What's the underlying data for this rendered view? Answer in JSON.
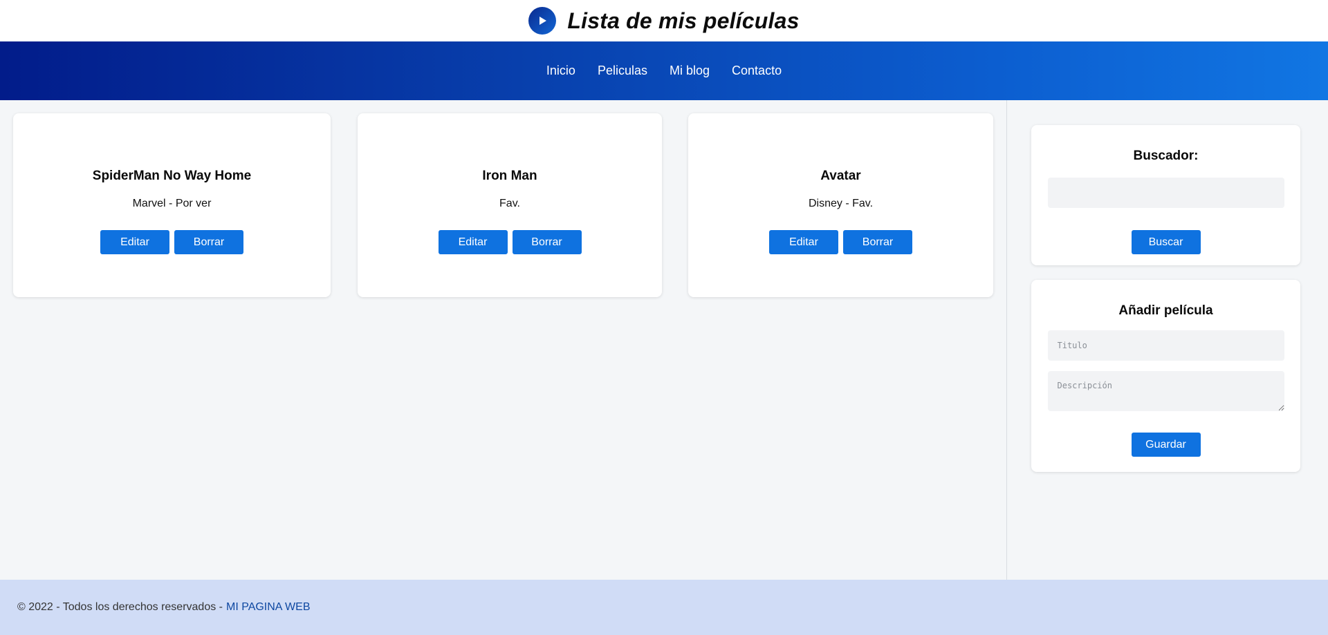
{
  "header": {
    "title": "Lista de mis películas",
    "logo_icon": "play-icon"
  },
  "nav": {
    "items": [
      "Inicio",
      "Peliculas",
      "Mi blog",
      "Contacto"
    ]
  },
  "movies": [
    {
      "title": "SpiderMan No Way Home",
      "description": "Marvel - Por ver",
      "edit_label": "Editar",
      "delete_label": "Borrar"
    },
    {
      "title": "Iron Man",
      "description": "Fav.",
      "edit_label": "Editar",
      "delete_label": "Borrar"
    },
    {
      "title": "Avatar",
      "description": "Disney - Fav.",
      "edit_label": "Editar",
      "delete_label": "Borrar"
    }
  ],
  "search": {
    "title": "Buscador:",
    "value": "",
    "button_label": "Buscar"
  },
  "add_movie": {
    "title": "Añadir película",
    "title_placeholder": "Titulo",
    "description_placeholder": "Descripción",
    "button_label": "Guardar"
  },
  "footer": {
    "text": "© 2022 - Todos los derechos reservados -",
    "link": "MI PAGINA WEB"
  },
  "colors": {
    "accent": "#0f72e0",
    "nav_start": "#021c8a",
    "nav_end": "#1176e3",
    "footer_bg": "#d0dcf6",
    "page_bg": "#f4f6f8"
  }
}
